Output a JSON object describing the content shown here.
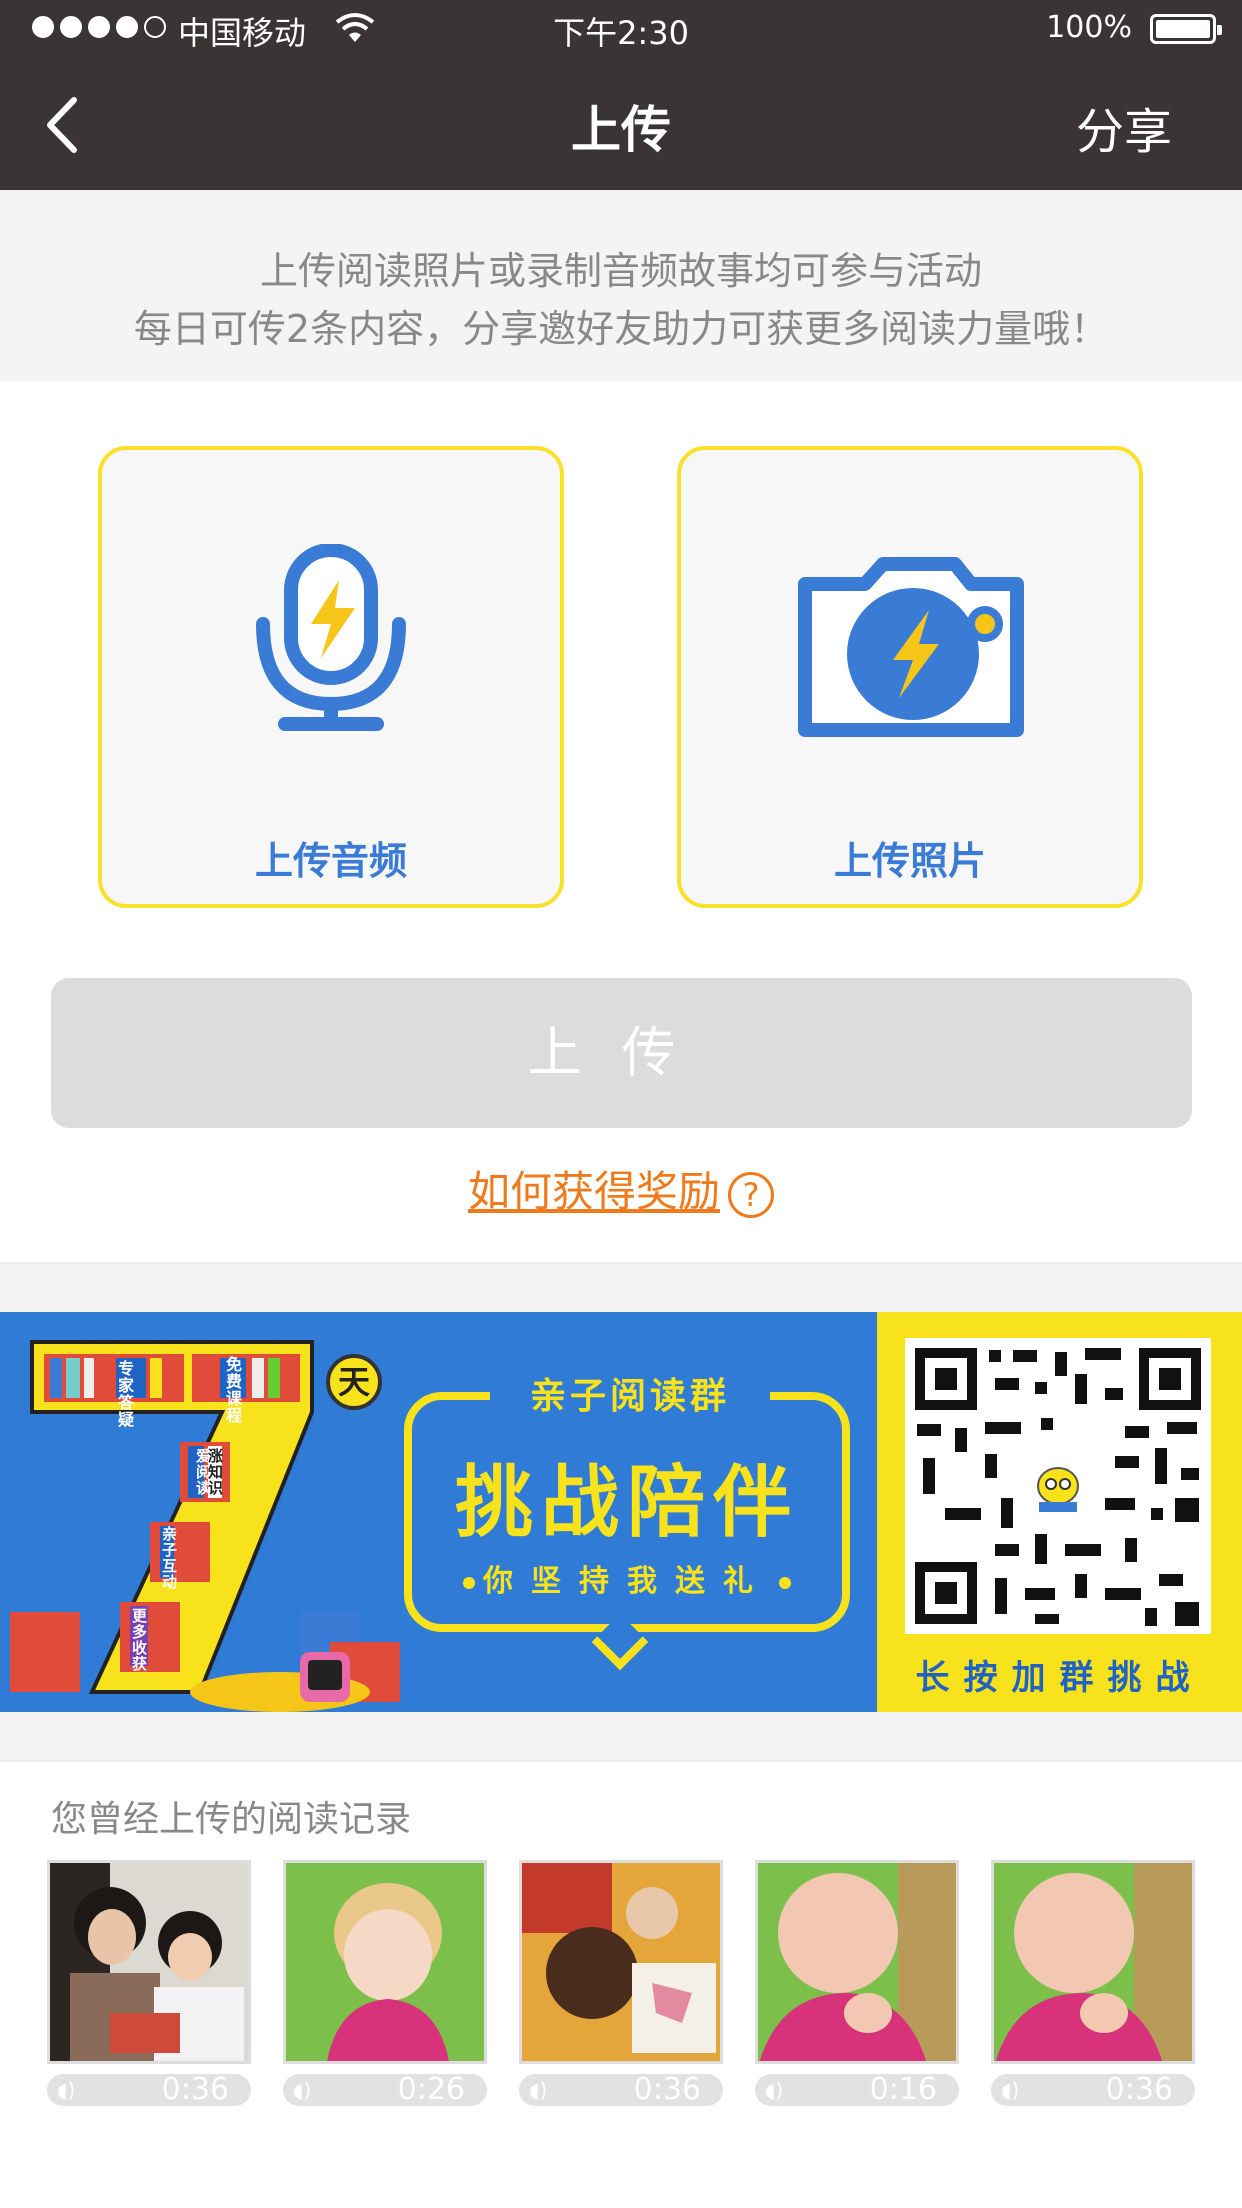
{
  "status_bar": {
    "carrier": "中国移动",
    "time": "下午2:30",
    "battery": "100%"
  },
  "nav": {
    "title": "上传",
    "share": "分享"
  },
  "notice": {
    "line1": "上传阅读照片或录制音频故事均可参与活动",
    "line2": "每日可传2条内容，分享邀好友助力可获更多阅读力量哦！"
  },
  "cards": {
    "audio_label": "上传音频",
    "photo_label": "上传照片"
  },
  "upload_button": "上传",
  "reward_link": "如何获得奖励",
  "reward_help": "?",
  "banner": {
    "day_badge": "天",
    "book_labels": [
      "专家答疑",
      "免费课程",
      "爱阅读",
      "涨知识",
      "亲子互动",
      "更多收获"
    ],
    "subtitle_top": "亲子阅读群",
    "main_title": "挑战陪伴",
    "slogan": "你坚持我送礼",
    "qr_caption": "长按加群挑战"
  },
  "history": {
    "title": "您曾经上传的阅读记录",
    "items": [
      {
        "duration": "0:36"
      },
      {
        "duration": "0:26"
      },
      {
        "duration": "0:36"
      },
      {
        "duration": "0:16"
      },
      {
        "duration": "0:36"
      }
    ]
  },
  "colors": {
    "nav_bg": "#3a3534",
    "accent_blue": "#3a7bd5",
    "card_border": "#f8e12a",
    "link_orange": "#f07a1b",
    "banner_blue": "#2f7bd6",
    "banner_yellow": "#f7e21c"
  }
}
